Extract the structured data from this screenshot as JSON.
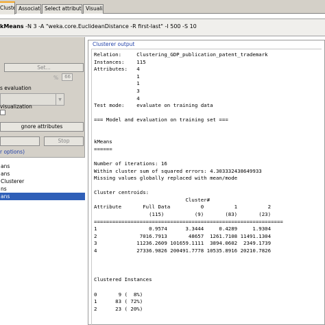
{
  "tabs": [
    {
      "label": "Cluster",
      "active": true
    },
    {
      "label": "Associate",
      "active": false
    },
    {
      "label": "Select attributes",
      "active": false
    },
    {
      "label": "Visualize",
      "active": false
    }
  ],
  "command": {
    "name": "kMeans",
    "args": " -N 3 -A \"weka.core.EuclideanDistance -R first-last\" -I 500 -S 10"
  },
  "left_panel": {
    "set_button": "Set...",
    "percent_sign": "%",
    "percent_value": "66",
    "eval_label": "s evaluation",
    "visualization_label": "visualization",
    "ignore_button": "gnore attributes",
    "stop_button": "Stop",
    "result_list_header": "r options)",
    "results": [
      {
        "label": "ans",
        "selected": false
      },
      {
        "label": "ans",
        "selected": false
      },
      {
        "label": "Clusterer",
        "selected": false
      },
      {
        "label": "ns",
        "selected": false
      },
      {
        "label": "ans",
        "selected": true
      }
    ]
  },
  "output": {
    "title": "Clusterer output",
    "lines": [
      "Relation:     Clustering_GDP_publication_patent_trademark",
      "Instances:    115",
      "Attributes:   4",
      "              1",
      "              1",
      "              3",
      "              4",
      "Test mode:    evaluate on training data",
      "",
      "=== Model and evaluation on training set ===",
      "",
      "",
      "kMeans",
      "======",
      "",
      "Number of iterations: 16",
      "Within cluster sum of squared errors: 4.303332438649933",
      "Missing values globally replaced with mean/mode",
      "",
      "Cluster centroids:",
      "                              Cluster#",
      "Attribute       Full Data          0          1          2",
      "                  (115)          (9)       (83)       (23)",
      "==============================================================",
      "1                 0.9574      3.3444     0.4289     1.9304",
      "2              7016.7913       48657  1261.7108 11491.1304",
      "3             11236.2609 101659.1111  3894.0602  2349.1739",
      "4             27336.9826 200491.7778 10535.8916 20210.7826",
      "",
      "",
      "",
      "Clustered Instances",
      "",
      "0       9 (  8%)",
      "1      83 ( 72%)",
      "2      23 ( 20%)"
    ]
  }
}
